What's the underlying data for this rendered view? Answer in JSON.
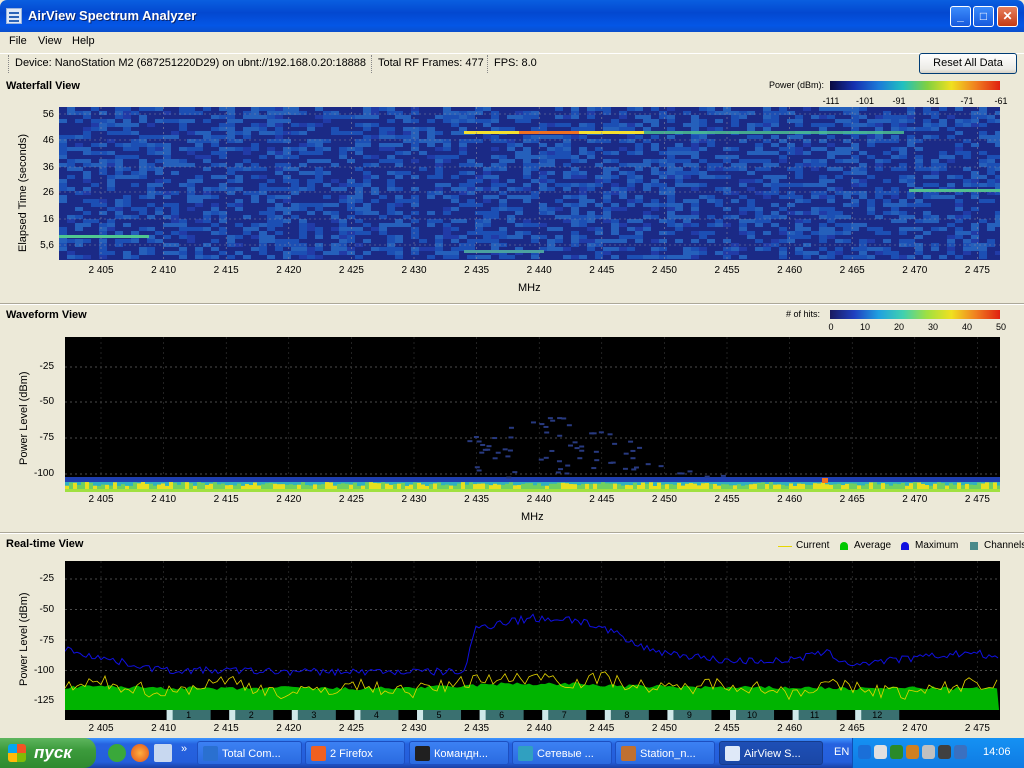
{
  "window": {
    "title": "AirView Spectrum Analyzer",
    "controls": [
      "_",
      "□",
      "✕"
    ]
  },
  "menu": [
    "File",
    "View",
    "Help"
  ],
  "toolbar": {
    "device": "Device: NanoStation M2 (687251220D29) on ubnt://192.168.0.20:18888",
    "frames": "Total RF Frames: 477",
    "fps": "FPS: 8.0",
    "reset_label": "Reset All Data"
  },
  "waterfall": {
    "title": "Waterfall View",
    "ylabel": "Elapsed Time (seconds)",
    "xlabel": "MHz",
    "yticks": [
      "56",
      "46",
      "36",
      "26",
      "16",
      "5,6"
    ],
    "colorbar_title": "Power (dBm):",
    "colorbar_ticks": [
      "-111",
      "-101",
      "-91",
      "-81",
      "-71",
      "-61"
    ]
  },
  "waveform": {
    "title": "Waveform View",
    "ylabel": "Power Level (dBm)",
    "xlabel": "MHz",
    "yticks": [
      "-25",
      "-50",
      "-75",
      "-100"
    ],
    "colorbar_title": "# of hits:",
    "colorbar_ticks": [
      "0",
      "10",
      "20",
      "30",
      "40",
      "50"
    ]
  },
  "realtime": {
    "title": "Real-time View",
    "ylabel": "Power Level (dBm)",
    "yticks": [
      "-25",
      "-50",
      "-75",
      "-100",
      "-125"
    ],
    "legend": [
      "Current",
      "Average",
      "Maximum",
      "Channels"
    ],
    "legend_colors": [
      "#e6d600",
      "#00c800",
      "#1010e0",
      "#4a8a8a"
    ],
    "channels": [
      "1",
      "2",
      "3",
      "4",
      "5",
      "6",
      "7",
      "8",
      "9",
      "10",
      "11",
      "12"
    ]
  },
  "xticks": [
    "2 405",
    "2 410",
    "2 415",
    "2 420",
    "2 425",
    "2 430",
    "2 435",
    "2 440",
    "2 445",
    "2 450",
    "2 455",
    "2 460",
    "2 465",
    "2 470",
    "2 475"
  ],
  "chart_data": [
    {
      "type": "heatmap",
      "title": "Waterfall View",
      "xlabel": "MHz",
      "ylabel": "Elapsed Time (seconds)",
      "xlim": [
        2402,
        2477
      ],
      "ylim": [
        0,
        60
      ],
      "color_scale": "Power (dBm) -111 to -61"
    },
    {
      "type": "heatmap",
      "title": "Waveform View",
      "xlabel": "MHz",
      "ylabel": "Power Level (dBm)",
      "xlim": [
        2402,
        2477
      ],
      "ylim": [
        -112,
        0
      ],
      "color_scale": "# of hits 0 to 50"
    },
    {
      "type": "line",
      "title": "Real-time View",
      "ylabel": "Power Level (dBm)",
      "xlim": [
        2402,
        2477
      ],
      "ylim": [
        -135,
        -15
      ],
      "x": [
        2402,
        2405,
        2410,
        2415,
        2420,
        2425,
        2430,
        2434,
        2435,
        2437,
        2440,
        2443,
        2445,
        2448,
        2450,
        2455,
        2460,
        2463,
        2465,
        2470,
        2475,
        2477
      ],
      "series": [
        {
          "name": "Maximum",
          "values": [
            -82,
            -90,
            -100,
            -100,
            -101,
            -101,
            -101,
            -101,
            -65,
            -60,
            -57,
            -58,
            -65,
            -80,
            -85,
            -92,
            -92,
            -85,
            -95,
            -90,
            -85,
            -92
          ]
        },
        {
          "name": "Average",
          "values": [
            -114,
            -113,
            -114,
            -115,
            -114,
            -115,
            -114,
            -113,
            -112,
            -111,
            -111,
            -111,
            -112,
            -113,
            -113,
            -114,
            -114,
            -114,
            -115,
            -114,
            -115,
            -114
          ]
        },
        {
          "name": "Current",
          "values": [
            -115,
            -110,
            -118,
            -108,
            -120,
            -112,
            -117,
            -110,
            -105,
            -108,
            -104,
            -110,
            -106,
            -112,
            -116,
            -110,
            -118,
            -112,
            -114,
            -119,
            -110,
            -113
          ]
        }
      ]
    }
  ],
  "taskbar": {
    "start": "пуск",
    "tasks": [
      "Total Com...",
      "2 Firefox",
      "Командн...",
      "Сетевые ...",
      "Station_n...",
      "AirView S..."
    ],
    "lang": "EN",
    "clock": "14:06"
  }
}
